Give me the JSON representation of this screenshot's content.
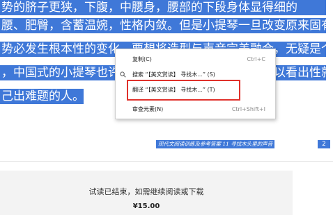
{
  "document": {
    "lines": [
      "势的脐子更狭，下腹，中腰身，腰部的下段身体显得细的",
      "腰、肥臀，含蓄温婉，性格内敛。但是小提琴一旦改变原来固有",
      "势必发生根本性的变化，要想将造型与声音完美融合，无疑是个",
      "，中国式的小提琴也许就无从谈起了，在这里我们可以看出性就",
      "己出难题的人。"
    ],
    "footer_text": "现代文阅读训练及参考答案 11 寻找木头里的声音",
    "page_number": "2"
  },
  "context_menu": {
    "items": [
      {
        "label": "复制(C)",
        "shortcut": "Ctrl+C"
      },
      {
        "label": "搜索 “【美文赏读】 寻找木...” (S)",
        "shortcut": ""
      },
      {
        "label": "翻译 “【美文赏读】 寻找木...” (T)",
        "shortcut": ""
      },
      {
        "label": "审查元素(N)",
        "shortcut": "Ctrl+Shift+I"
      }
    ],
    "highlight_color": "#e0312b"
  },
  "paywall": {
    "message": "试读已结束，如需继续阅读或下载",
    "price": "¥15.00"
  },
  "colors": {
    "selection": "#3f78d8",
    "paywall_bg": "#f3f3f3"
  },
  "icons": [
    "search-icon"
  ]
}
